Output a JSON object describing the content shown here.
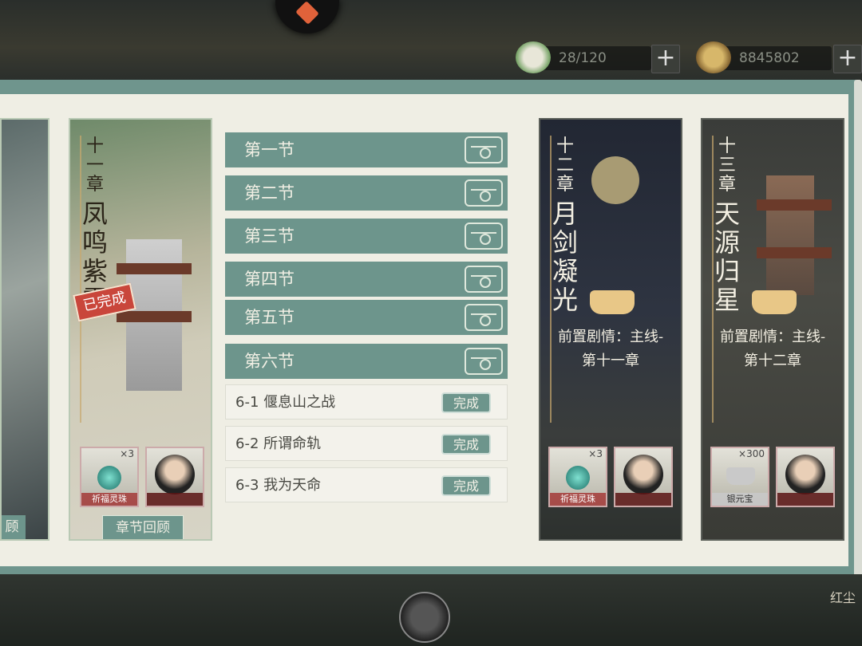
{
  "topbar": {
    "stamina": {
      "value": "28/120",
      "plus": "+",
      "icon": "peach-icon"
    },
    "silver": {
      "value": "8845802",
      "plus": "+",
      "icon": "silver-ingot-icon"
    }
  },
  "prev_chapter": {
    "review_label": "顾"
  },
  "chapter11": {
    "chapter": "十一章",
    "name": "凤鸣紫霄",
    "stamp": "已完成",
    "rewards": [
      {
        "count": "×3",
        "label": "祈福灵珠"
      },
      {
        "count": "",
        "label": ""
      }
    ],
    "review_label": "章节回顾"
  },
  "sections": [
    {
      "label": "第一节"
    },
    {
      "label": "第二节"
    },
    {
      "label": "第三节"
    },
    {
      "label": "第四节"
    },
    {
      "label": "第五节"
    },
    {
      "label": "第六节"
    }
  ],
  "subsections": [
    {
      "label": "6-1 偃息山之战",
      "status": "完成"
    },
    {
      "label": "6-2 所谓命轨",
      "status": "完成"
    },
    {
      "label": "6-3 我为天命",
      "status": "完成"
    }
  ],
  "chapter12": {
    "chapter": "十二章",
    "name": "月剑凝光",
    "prereq_line1": "前置剧情：主线-",
    "prereq_line2": "第十一章",
    "rewards": [
      {
        "count": "×3",
        "label": "祈福灵珠"
      },
      {
        "count": "",
        "label": ""
      }
    ]
  },
  "chapter13": {
    "chapter": "十三章",
    "name": "天源归星",
    "prereq_line1": "前置剧情：主线-",
    "prereq_line2": "第十二章",
    "rewards": [
      {
        "count": "×300",
        "label": "银元宝"
      },
      {
        "count": "",
        "label": ""
      }
    ]
  },
  "bottom": {
    "right_text": "红尘"
  }
}
